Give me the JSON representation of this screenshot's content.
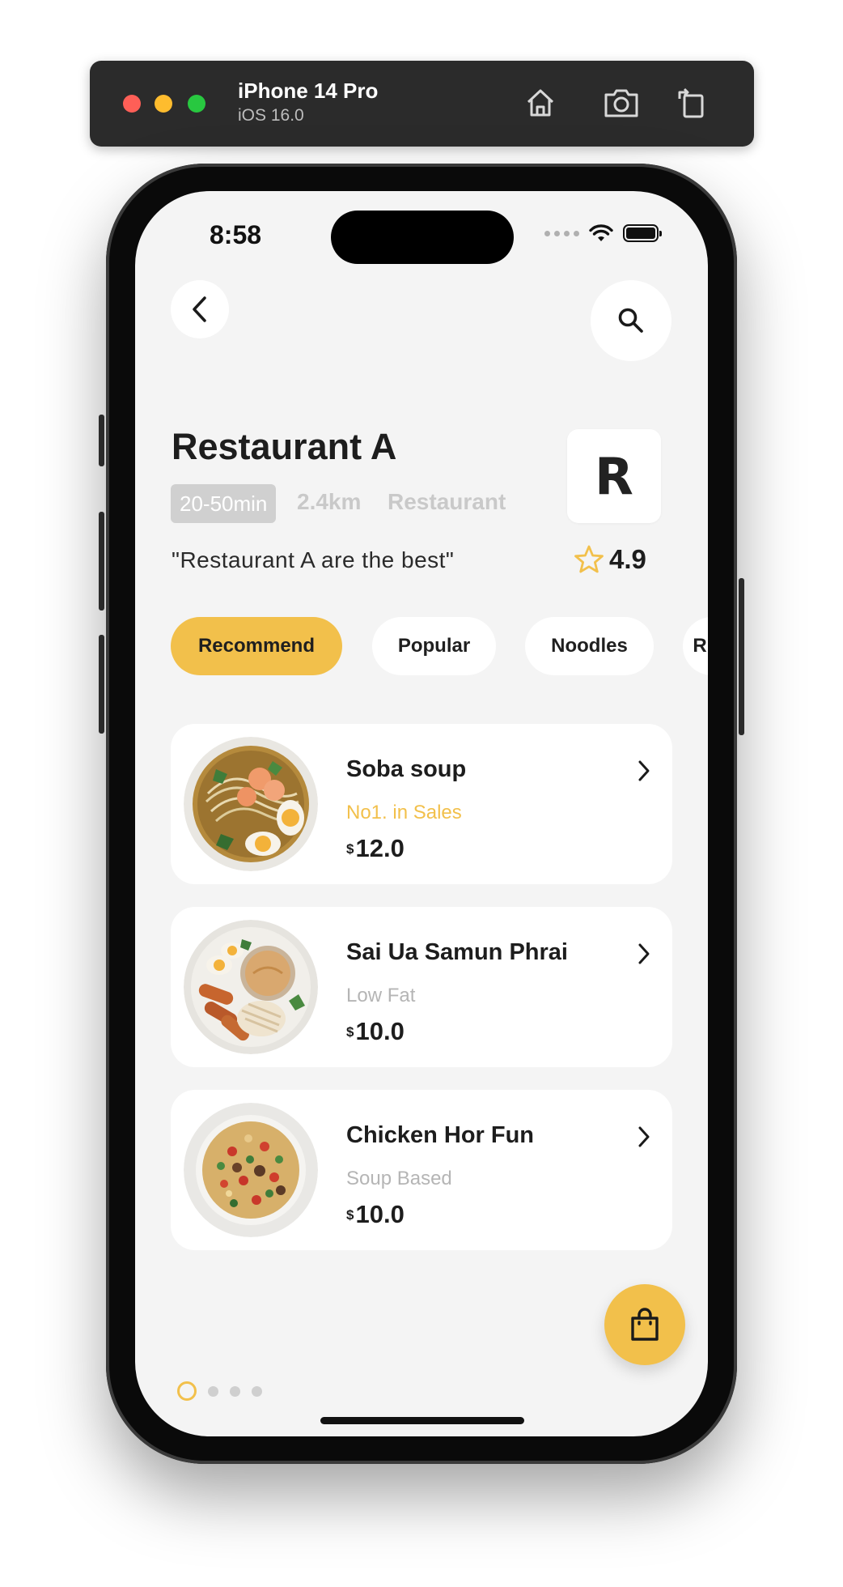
{
  "simulator": {
    "device_name": "iPhone 14 Pro",
    "os_version": "iOS 16.0",
    "icons": [
      "home-icon",
      "screenshot-icon",
      "rotate-icon"
    ]
  },
  "status_bar": {
    "time": "8:58"
  },
  "restaurant": {
    "name": "Restaurant A",
    "delivery_time": "20-50min",
    "distance": "2.4km",
    "type": "Restaurant",
    "tagline": "\"Restaurant A are the best\"",
    "rating": "4.9",
    "logo_letter": "R"
  },
  "tabs": [
    {
      "label": "Recommend",
      "active": true
    },
    {
      "label": "Popular",
      "active": false
    },
    {
      "label": "Noodles",
      "active": false
    },
    {
      "label": "R",
      "active": false
    }
  ],
  "dishes": [
    {
      "name": "Soba soup",
      "tag": "No1. in Sales",
      "currency": "$",
      "price": "12.0",
      "highlight": true
    },
    {
      "name": "Sai Ua Samun Phrai",
      "tag": "Low Fat",
      "currency": "$",
      "price": "10.0",
      "highlight": false
    },
    {
      "name": "Chicken Hor Fun",
      "tag": "Soup Based",
      "currency": "$",
      "price": "10.0",
      "highlight": false
    }
  ],
  "pager": {
    "total": 4,
    "active_index": 0
  },
  "colors": {
    "accent": "#f2c04b",
    "background": "#f4f4f4",
    "card": "#ffffff",
    "text": "#1d1d1d",
    "muted": "#b5b5b5"
  }
}
